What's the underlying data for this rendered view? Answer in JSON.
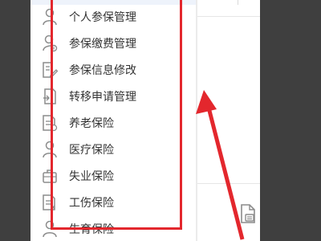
{
  "sidebar": {
    "items": [
      {
        "label": "个人参保管理",
        "icon": "person-icon"
      },
      {
        "label": "参保缴费管理",
        "icon": "user-badge-icon"
      },
      {
        "label": "参保信息修改",
        "icon": "edit-document-icon"
      },
      {
        "label": "转移申请管理",
        "icon": "transfer-document-icon"
      },
      {
        "label": "养老保险",
        "icon": "document-icon"
      },
      {
        "label": "医疗保险",
        "icon": "person-icon"
      },
      {
        "label": "失业保险",
        "icon": "briefcase-icon"
      },
      {
        "label": "工伤保险",
        "icon": "document-icon"
      },
      {
        "label": "生育保险",
        "icon": "person-icon"
      }
    ]
  },
  "annotation": {
    "highlight_color": "#e3272d"
  },
  "colors": {
    "background": "#3f3f3f",
    "panel": "#ffffff",
    "text": "#333333",
    "icon": "#8c8c8c"
  }
}
